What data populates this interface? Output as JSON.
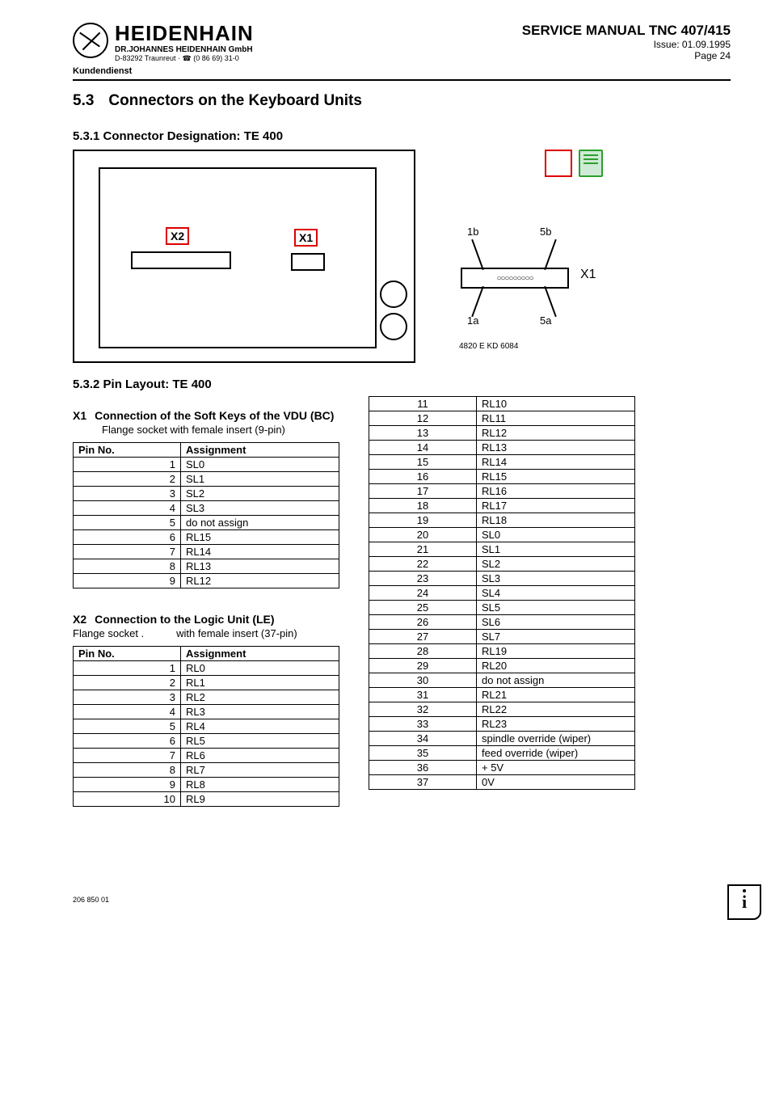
{
  "header": {
    "company": "HEIDENHAIN",
    "subsidiary": "DR.JOHANNES HEIDENHAIN GmbH",
    "address": "D-83292 Traunreut · ☎ (0 86 69) 31-0",
    "kundendienst": "Kundendienst",
    "manual_title": "SERVICE MANUAL TNC 407/415",
    "issue": "Issue: 01.09.1995",
    "page": "Page 24"
  },
  "section": {
    "num": "5.3",
    "title": "Connectors on the Keyboard Units"
  },
  "sub531": "5.3.1 Connector Designation: TE 400",
  "sub532": "5.3.2 Pin Layout: TE 400",
  "diagram": {
    "x2": "X2",
    "x1": "X1",
    "x1_name": "X1",
    "pins": {
      "p1b": "1b",
      "p5b": "5b",
      "p1a": "1a",
      "p5a": "5a"
    },
    "figref": "4820 E KD 6084"
  },
  "x1": {
    "code": "X1",
    "title": "Connection of the Soft Keys of the VDU (BC)",
    "desc": "Flange socket with female insert (9-pin)",
    "cols": {
      "pin": "Pin No.",
      "assign": "Assignment"
    },
    "rows": [
      {
        "pin": "1",
        "assign": "SL0"
      },
      {
        "pin": "2",
        "assign": "SL1"
      },
      {
        "pin": "3",
        "assign": "SL2"
      },
      {
        "pin": "4",
        "assign": "SL3"
      },
      {
        "pin": "5",
        "assign": "do not assign"
      },
      {
        "pin": "6",
        "assign": "RL15"
      },
      {
        "pin": "7",
        "assign": "RL14"
      },
      {
        "pin": "8",
        "assign": "RL13"
      },
      {
        "pin": "9",
        "assign": "RL12"
      }
    ]
  },
  "x2": {
    "code": "X2",
    "title": "Connection to the Logic Unit (LE)",
    "desc_a": "Flange socket .",
    "desc_b": "with female insert (37-pin)",
    "cols": {
      "pin": "Pin No.",
      "assign": "Assignment"
    },
    "rows_left": [
      {
        "pin": "1",
        "assign": "RL0"
      },
      {
        "pin": "2",
        "assign": "RL1"
      },
      {
        "pin": "3",
        "assign": "RL2"
      },
      {
        "pin": "4",
        "assign": "RL3"
      },
      {
        "pin": "5",
        "assign": "RL4"
      },
      {
        "pin": "6",
        "assign": "RL5"
      },
      {
        "pin": "7",
        "assign": "RL6"
      },
      {
        "pin": "8",
        "assign": "RL7"
      },
      {
        "pin": "9",
        "assign": "RL8"
      },
      {
        "pin": "10",
        "assign": "RL9"
      }
    ],
    "rows_right": [
      {
        "pin": "11",
        "assign": "RL10"
      },
      {
        "pin": "12",
        "assign": "RL11"
      },
      {
        "pin": "13",
        "assign": "RL12"
      },
      {
        "pin": "14",
        "assign": "RL13"
      },
      {
        "pin": "15",
        "assign": "RL14"
      },
      {
        "pin": "16",
        "assign": "RL15"
      },
      {
        "pin": "17",
        "assign": "RL16"
      },
      {
        "pin": "18",
        "assign": "RL17"
      },
      {
        "pin": "19",
        "assign": "RL18"
      },
      {
        "pin": "20",
        "assign": "SL0"
      },
      {
        "pin": "21",
        "assign": "SL1"
      },
      {
        "pin": "22",
        "assign": "SL2"
      },
      {
        "pin": "23",
        "assign": "SL3"
      },
      {
        "pin": "24",
        "assign": "SL4"
      },
      {
        "pin": "25",
        "assign": "SL5"
      },
      {
        "pin": "26",
        "assign": "SL6"
      },
      {
        "pin": "27",
        "assign": "SL7"
      },
      {
        "pin": "28",
        "assign": "RL19"
      },
      {
        "pin": "29",
        "assign": "RL20"
      },
      {
        "pin": "30",
        "assign": "do not assign"
      },
      {
        "pin": "31",
        "assign": "RL21"
      },
      {
        "pin": "32",
        "assign": "RL22"
      },
      {
        "pin": "33",
        "assign": "RL23"
      },
      {
        "pin": "34",
        "assign": "spindle override (wiper)"
      },
      {
        "pin": "35",
        "assign": "feed override (wiper)"
      },
      {
        "pin": "36",
        "assign": "+ 5V"
      },
      {
        "pin": "37",
        "assign": "0V"
      }
    ]
  },
  "footer_code": "206 850 01",
  "info_char": "i"
}
